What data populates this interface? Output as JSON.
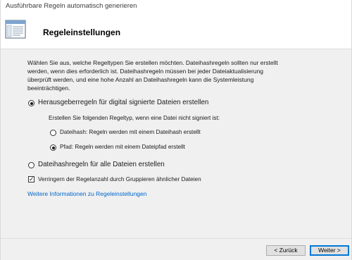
{
  "window": {
    "title": "Ausführbare Regeln automatisch generieren"
  },
  "header": {
    "title": "Regeleinstellungen",
    "icon": "settings-page-icon"
  },
  "description": "Wählen Sie aus, welche Regeltypen Sie erstellen möchten. Dateihashregeln sollten nur erstellt werden, wenn dies erforderlich ist. Dateihashregeln müssen bei jeder Dateiaktualisierung überprüft werden, und eine hohe Anzahl an Dateihashregeln kann die Systemleistung beeinträchtigen.",
  "options": {
    "publisher_rules": {
      "label": "Herausgeberregeln für digital signierte Dateien erstellen",
      "checked": true
    },
    "unsigned_prompt": "Erstellen Sie folgenden Regeltyp, wenn eine Datei nicht signiert ist:",
    "file_hash": {
      "label": "Dateihash: Regeln werden mit einem Dateihash erstellt",
      "checked": false
    },
    "path": {
      "label": "Pfad: Regeln werden mit einem Dateipfad erstellt",
      "checked": true
    },
    "hash_all": {
      "label": "Dateihashregeln für alle Dateien erstellen",
      "checked": false
    },
    "reduce_rules": {
      "label": "Verringern der Regelanzahl durch Gruppieren ähnlicher Dateien",
      "checked": true
    }
  },
  "more_info_link": "Weitere Informationen zu Regeleinstellungen",
  "footer": {
    "back_label": "< Zurück",
    "next_label": "Weiter >"
  },
  "colors": {
    "link": "#0066cc",
    "accent": "#0078d7",
    "body_bg": "#f0f0f0"
  }
}
